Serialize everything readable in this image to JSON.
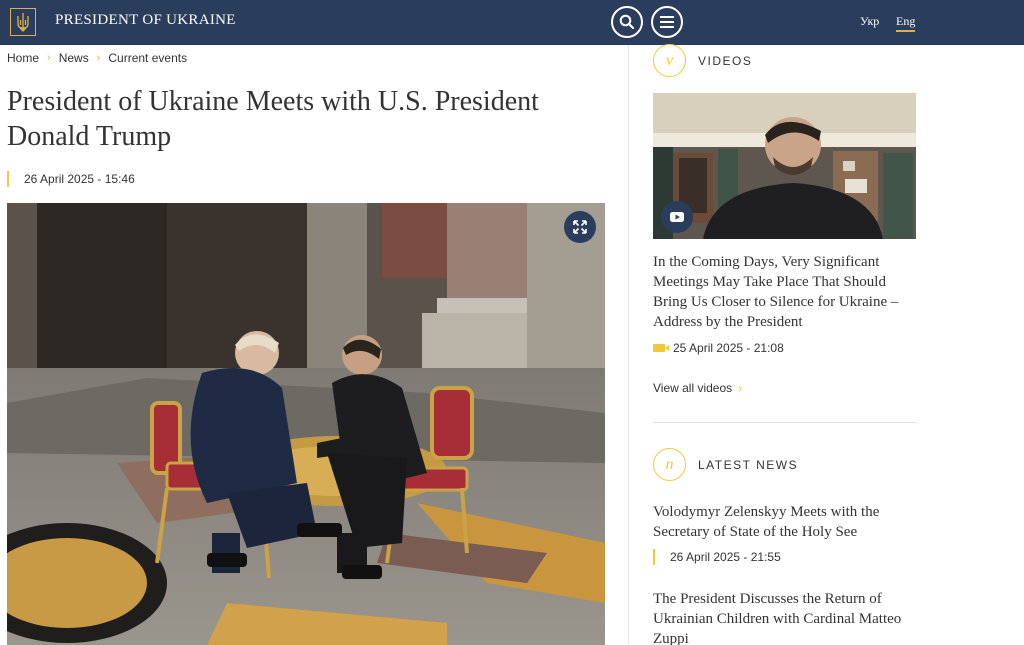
{
  "header": {
    "title": "PRESIDENT OF UKRAINE",
    "lang_uk": "Укр",
    "lang_en": "Eng",
    "brand_color": "#2b3d5d",
    "accent_color": "#f0c93a"
  },
  "breadcrumb": {
    "home": "Home",
    "news": "News",
    "current": "Current events"
  },
  "article": {
    "title": "President of Ukraine Meets with U.S. President Donald Trump",
    "date": "26 April 2025 - 15:46",
    "photo_icon": "expand-icon"
  },
  "videos": {
    "label": "VIDEOS",
    "icon_letter": "v",
    "item_title": "In the Coming Days, Very Significant Meetings May Take Place That Should Bring Us Closer to Silence for Ukraine – Address by the President",
    "item_date": "25 April 2025 - 21:08",
    "view_all": "View all videos"
  },
  "latest_news": {
    "label": "LATEST NEWS",
    "icon_letter": "n",
    "items": [
      {
        "title": "Volodymyr Zelenskyy Meets with the Secretary of State of the Holy See",
        "date": "26 April 2025 - 21:55"
      },
      {
        "title": "The President Discusses the Return of Ukrainian Children with Cardinal Matteo Zuppi",
        "date": ""
      }
    ]
  }
}
